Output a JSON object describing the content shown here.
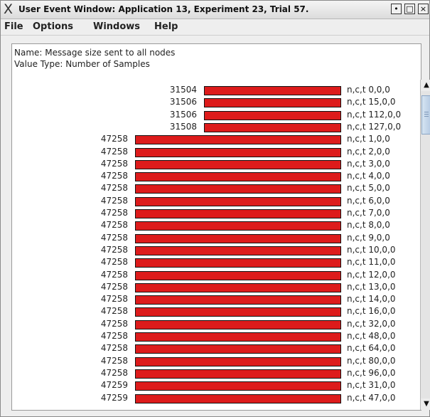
{
  "window": {
    "title": "User Event Window: Application 13, Experiment 23, Trial 57.",
    "x_glyph": "X",
    "btn_min": "•",
    "btn_max": "□",
    "btn_close": "×"
  },
  "menu": {
    "items": [
      "File",
      "Options",
      "Windows",
      "Help"
    ]
  },
  "info": {
    "name_line": "Name: Message size sent to all nodes",
    "type_line": "Value Type: Number of Samples"
  },
  "colors": {
    "bar_fill": "#dd1b1b",
    "bar_border": "#111111",
    "background": "#ffffff"
  },
  "scrollbar": {
    "up_glyph": "▲",
    "down_glyph": "▼",
    "position_fraction": 0.0
  },
  "chart_data": {
    "type": "bar",
    "orientation": "horizontal",
    "categories": [
      "n,c,t 0,0,0",
      "n,c,t 15,0,0",
      "n,c,t 112,0,0",
      "n,c,t 127,0,0",
      "n,c,t 1,0,0",
      "n,c,t 2,0,0",
      "n,c,t 3,0,0",
      "n,c,t 4,0,0",
      "n,c,t 5,0,0",
      "n,c,t 6,0,0",
      "n,c,t 7,0,0",
      "n,c,t 8,0,0",
      "n,c,t 9,0,0",
      "n,c,t 10,0,0",
      "n,c,t 11,0,0",
      "n,c,t 12,0,0",
      "n,c,t 13,0,0",
      "n,c,t 14,0,0",
      "n,c,t 16,0,0",
      "n,c,t 32,0,0",
      "n,c,t 48,0,0",
      "n,c,t 64,0,0",
      "n,c,t 80,0,0",
      "n,c,t 96,0,0",
      "n,c,t 31,0,0",
      "n,c,t 47,0,0"
    ],
    "values": [
      31504,
      31506,
      31506,
      31508,
      47258,
      47258,
      47258,
      47258,
      47258,
      47258,
      47258,
      47258,
      47258,
      47258,
      47258,
      47258,
      47258,
      47258,
      47258,
      47258,
      47258,
      47258,
      47258,
      47258,
      47259,
      47259
    ],
    "xlim": [
      0,
      47259
    ]
  }
}
